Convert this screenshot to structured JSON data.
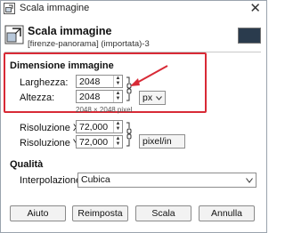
{
  "window": {
    "title": "Scala immagine",
    "close_glyph": "✕"
  },
  "header": {
    "title": "Scala immagine",
    "subtitle": "[firenze-panorama] (importata)-3"
  },
  "image_size": {
    "section_title": "Dimensione immagine",
    "width_label": "Larghezza:",
    "width_value": "2048",
    "height_label": "Altezza:",
    "height_value": "2048",
    "size_info": "2048 × 2048 pixel",
    "unit_value": "px"
  },
  "resolution": {
    "x_label": "Risoluzione X:",
    "x_value": "72,000",
    "y_label": "Risoluzione Y:",
    "y_value": "72,000",
    "unit_value": "pixel/in"
  },
  "quality": {
    "section_title": "Qualità",
    "interp_label": "Interpolazione:",
    "interp_value": "Cubica"
  },
  "buttons": {
    "help": "Aiuto",
    "reset": "Reimposta",
    "scale": "Scala",
    "cancel": "Annulla"
  },
  "colors": {
    "highlight": "#d82a36",
    "arrow": "#d82a36"
  }
}
